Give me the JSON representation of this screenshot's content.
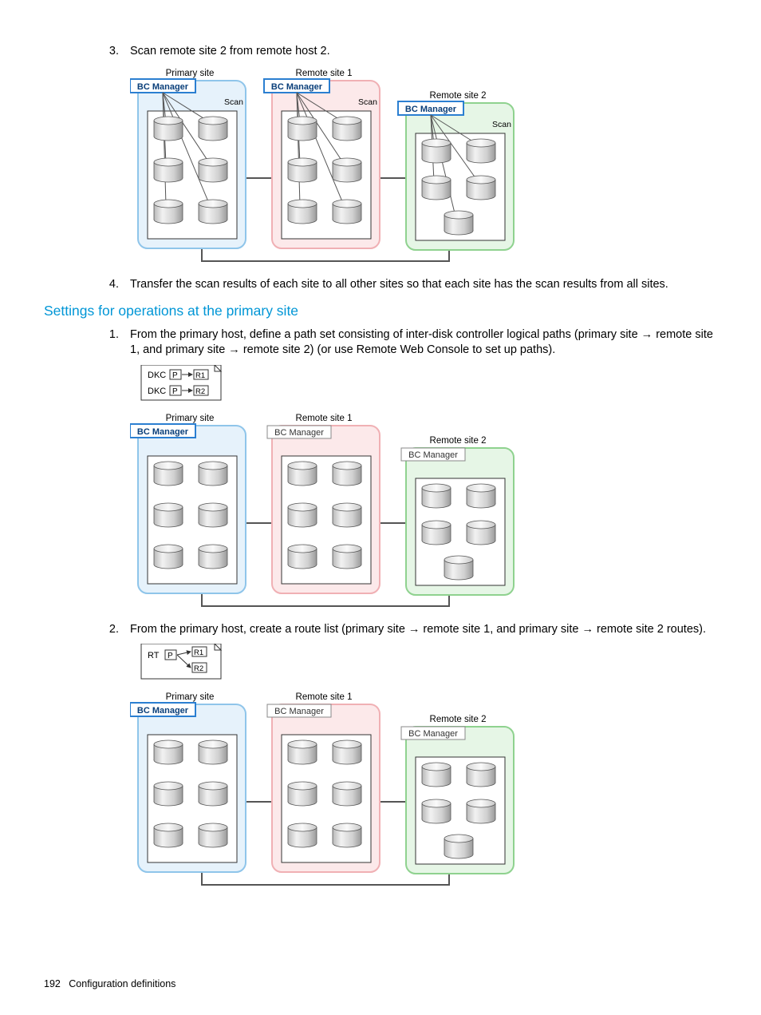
{
  "items": {
    "i3": {
      "num": "3.",
      "text": "Scan remote site 2 from remote host 2."
    },
    "i4": {
      "num": "4.",
      "text": "Transfer the scan results of each site to all other sites so that each site has the scan results from all sites."
    },
    "p1": {
      "num": "1.",
      "text": "From the primary host, define a path set consisting of inter-disk controller logical paths (primary site → remote site 1, and primary site → remote site 2) (or use Remote Web Console to set up paths)."
    },
    "p2": {
      "num": "2.",
      "text": "From the primary host, create a route list (primary site → remote site 1, and primary site → remote site 2 routes)."
    }
  },
  "heading": "Settings for operations at the primary site",
  "labels": {
    "primary": "Primary site",
    "remote1": "Remote site 1",
    "remote2": "Remote site 2",
    "bcm": "BC Manager",
    "scan": "Scan",
    "dkc": "DKC",
    "rt": "RT",
    "p": "P",
    "r1": "R1",
    "r2": "R2"
  },
  "footer": {
    "page": "192",
    "section": "Configuration definitions"
  }
}
